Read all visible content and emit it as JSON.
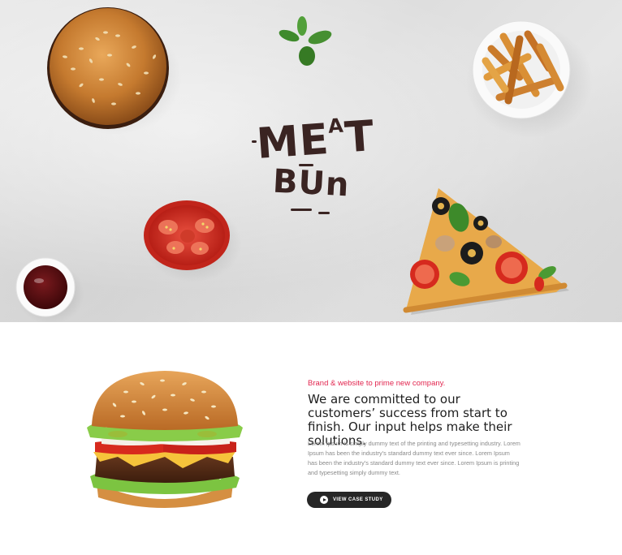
{
  "hero": {
    "logo_line1_big": "ME",
    "logo_line1_small": "A",
    "logo_line1_end": "T",
    "logo_line2": "BUn",
    "items": [
      "bun-top",
      "basil-leaves",
      "fries-bowl",
      "tomato-half",
      "ketchup-bowl",
      "pizza-slice"
    ]
  },
  "feature": {
    "tagline": "Brand & website to prime new company.",
    "headline": "We are committed to our customers’ success from start to finish. Our input helps make their solutions.",
    "body": "Lorem Ipsum is simply dummy text of the printing and typesetting industry. Lorem Ipsum has been the industry’s standard dummy text ever since. Lorem Ipsum has been the industry’s standard dummy text ever since. Lorem Ipsum is printing and typesetting simply dummy text.",
    "cta_label": "VIEW CASE STUDY",
    "cta_icon": "play-icon"
  },
  "colors": {
    "accent": "#e2264f",
    "logo": "#3a2422",
    "button": "#262626"
  }
}
